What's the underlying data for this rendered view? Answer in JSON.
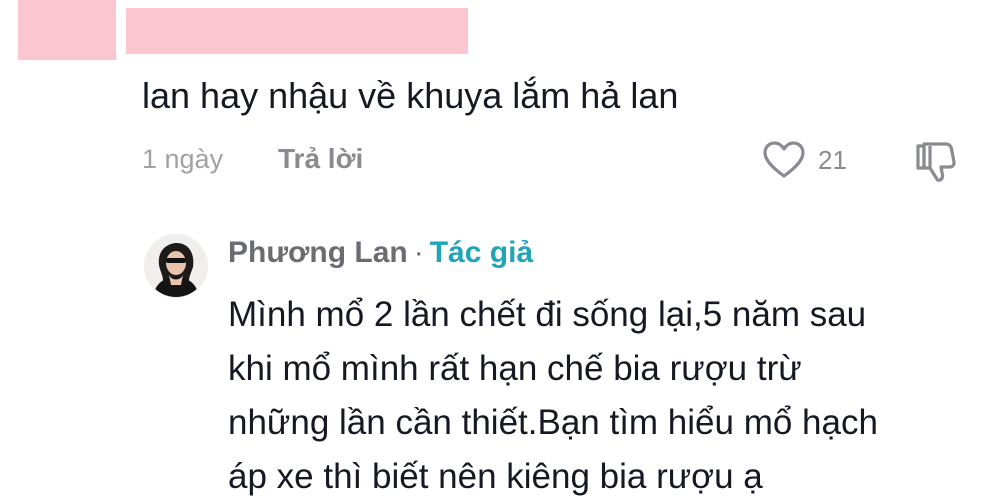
{
  "comment": {
    "text": "lan hay nhậu về khuya lắm hả lan",
    "time": "1 ngày",
    "reply_label": "Trả lời",
    "like_count": "21",
    "icons": {
      "like": "heart-outline-icon",
      "dislike": "thumbs-down-icon"
    },
    "redaction_color": "#fbc6d0"
  },
  "reply": {
    "author": "Phương Lan",
    "separator": "·",
    "badge": "Tác giả",
    "badge_color": "#20a4b8",
    "lines": [
      "Mình mổ 2 lần chết đi sống lại,5 năm sau",
      "khi mổ mình rất hạn chế bia rượu trừ",
      "những lần cần thiết.Bạn tìm hiểu mổ hạch",
      "áp xe thì biết nên kiêng bia rượu ạ"
    ]
  }
}
